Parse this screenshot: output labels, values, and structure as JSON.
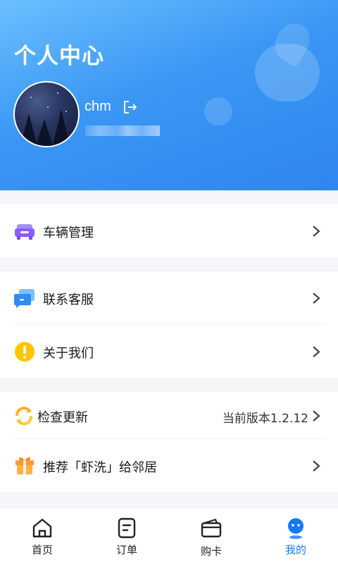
{
  "header": {
    "title": "个人中心",
    "username": "chm",
    "logout_icon": "logout-icon",
    "avatar_icon": "avatar"
  },
  "menu": {
    "vehicle": {
      "label": "车辆管理",
      "icon": "car-icon",
      "color": "#8b5cf6"
    },
    "support": {
      "label": "联系客服",
      "icon": "chat-icon",
      "color": "#2f8cf0"
    },
    "about": {
      "label": "关于我们",
      "icon": "info-icon",
      "color": "#ffc400"
    },
    "update": {
      "label": "检查更新",
      "value": "当前版本1.2.12",
      "icon": "refresh-icon",
      "color": "#ffb020"
    },
    "recommend": {
      "label": "推荐「虾洗」给邻居",
      "icon": "gift-icon",
      "color": "#ff9a2e"
    }
  },
  "tabs": [
    {
      "label": "首页",
      "icon": "home-icon"
    },
    {
      "label": "订单",
      "icon": "order-icon"
    },
    {
      "label": "购卡",
      "icon": "wallet-icon"
    },
    {
      "label": "我的",
      "icon": "profile-icon",
      "active": true
    }
  ],
  "colors": {
    "accent": "#1677ff",
    "header_start": "#6cc0ff",
    "header_end": "#2f86ef"
  }
}
